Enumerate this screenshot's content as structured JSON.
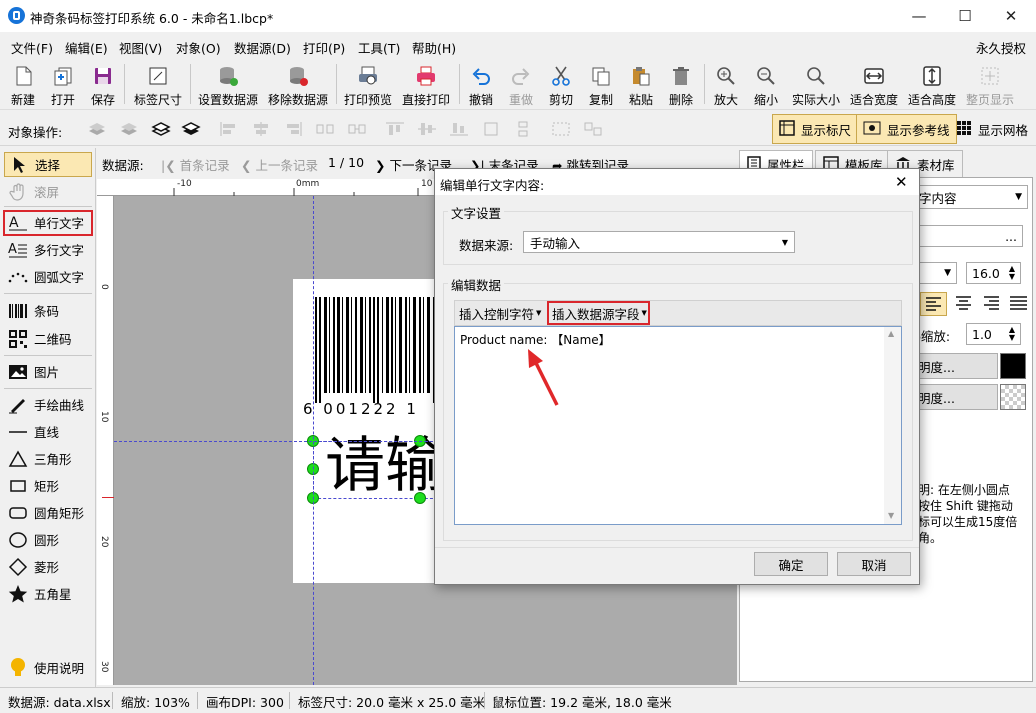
{
  "window": {
    "title": "神奇条码标签打印系统 6.0 - 未命名1.lbcp*",
    "minimize": "—",
    "maximize": "☐",
    "close": "✕"
  },
  "menu": [
    "文件(F)",
    "编辑(E)",
    "视图(V)",
    "对象(O)",
    "数据源(D)",
    "打印(P)",
    "工具(T)",
    "帮助(H)"
  ],
  "license": "永久授权",
  "toolbar": [
    {
      "label": "新建",
      "icon": "new-file-icon",
      "enabled": true
    },
    {
      "label": "打开",
      "icon": "open-icon",
      "enabled": true
    },
    {
      "label": "保存",
      "icon": "save-icon",
      "enabled": true
    },
    {
      "label": "标签尺寸",
      "icon": "label-size-icon",
      "enabled": true
    },
    {
      "label": "设置数据源",
      "icon": "database-icon",
      "enabled": true
    },
    {
      "label": "移除数据源",
      "icon": "database-remove-icon",
      "enabled": true
    },
    {
      "label": "打印预览",
      "icon": "print-preview-icon",
      "enabled": true
    },
    {
      "label": "直接打印",
      "icon": "printer-icon",
      "enabled": true
    },
    {
      "label": "撤销",
      "icon": "undo-icon",
      "enabled": true
    },
    {
      "label": "重做",
      "icon": "redo-icon",
      "enabled": false
    },
    {
      "label": "剪切",
      "icon": "scissors-icon",
      "enabled": true
    },
    {
      "label": "复制",
      "icon": "copy-icon",
      "enabled": true
    },
    {
      "label": "粘贴",
      "icon": "paste-icon",
      "enabled": true
    },
    {
      "label": "删除",
      "icon": "trash-icon",
      "enabled": true
    },
    {
      "label": "放大",
      "icon": "zoom-in-icon",
      "enabled": true
    },
    {
      "label": "缩小",
      "icon": "zoom-out-icon",
      "enabled": true
    },
    {
      "label": "实际大小",
      "icon": "actual-size-icon",
      "enabled": true
    },
    {
      "label": "适合宽度",
      "icon": "fit-width-icon",
      "enabled": true
    },
    {
      "label": "适合高度",
      "icon": "fit-height-icon",
      "enabled": true
    },
    {
      "label": "整页显示",
      "icon": "fit-page-icon",
      "enabled": false
    }
  ],
  "objbar": {
    "label": "对象操作:",
    "show_ruler": "显示标尺",
    "show_guides": "显示参考线",
    "show_grid": "显示网格"
  },
  "tools": [
    {
      "label": "选择",
      "icon": "cursor-arrow-icon"
    },
    {
      "label": "滚屏",
      "icon": "hand-icon"
    },
    {
      "label": "单行文字",
      "icon": "single-line-text-icon"
    },
    {
      "label": "多行文字",
      "icon": "multi-line-text-icon"
    },
    {
      "label": "圆弧文字",
      "icon": "arc-text-icon"
    },
    {
      "label": "条码",
      "icon": "barcode-icon"
    },
    {
      "label": "二维码",
      "icon": "qrcode-icon"
    },
    {
      "label": "图片",
      "icon": "image-icon"
    },
    {
      "label": "手绘曲线",
      "icon": "pen-icon"
    },
    {
      "label": "直线",
      "icon": "line-icon"
    },
    {
      "label": "三角形",
      "icon": "triangle-icon"
    },
    {
      "label": "矩形",
      "icon": "rectangle-icon"
    },
    {
      "label": "圆角矩形",
      "icon": "rounded-rectangle-icon"
    },
    {
      "label": "圆形",
      "icon": "circle-icon"
    },
    {
      "label": "菱形",
      "icon": "diamond-icon"
    },
    {
      "label": "五角星",
      "icon": "star-icon"
    },
    {
      "label": "使用说明",
      "icon": "lightbulb-icon"
    }
  ],
  "nav": {
    "label": "数据源:",
    "first": "首条记录",
    "prev": "上一条记录",
    "page": "1 / 10",
    "next": "下一条记录",
    "last": "末条记录",
    "goto": "跳转到记录"
  },
  "ruler": {
    "h": [
      "-10",
      "0mm",
      "10"
    ],
    "v": [
      "0",
      "10",
      "20",
      "30"
    ]
  },
  "canvas": {
    "barcode_digits": "6 001222 1",
    "text_preview": "请输"
  },
  "rightpanel": {
    "tabs": [
      "属性栏",
      "模板库",
      "素材库"
    ],
    "type_select": "字内容",
    "ellipsis": "...",
    "font_size": "16.0",
    "scale_label": "b缩放:",
    "scale_value": "1.0",
    "transparency1": "明度...",
    "transparency2": "明度...",
    "help": "明: 在左侧小圆点\n按住 Shift 键拖动\n标可以生成15度倍\n角。"
  },
  "status": {
    "datasource": "数据源: data.xlsx",
    "zoom": "缩放: 103%",
    "dpi": "画布DPI: 300",
    "size": "标签尺寸: 20.0 毫米 x 25.0 毫米",
    "mouse": "鼠标位置: 19.2 毫米, 18.0 毫米"
  },
  "dialog": {
    "title": "编辑单行文字内容:",
    "close": "✕",
    "group1": "文字设置",
    "source_label": "数据来源:",
    "source_value": "手动输入",
    "group2": "编辑数据",
    "insert_control": "插入控制字符",
    "insert_field": "插入数据源字段",
    "content": "Product name: 【Name】",
    "ok": "确定",
    "cancel": "取消"
  },
  "colors": {
    "accent": "#1673d8",
    "highlight_red": "#d9262c",
    "toggle_bg": "#fbe8b3"
  }
}
